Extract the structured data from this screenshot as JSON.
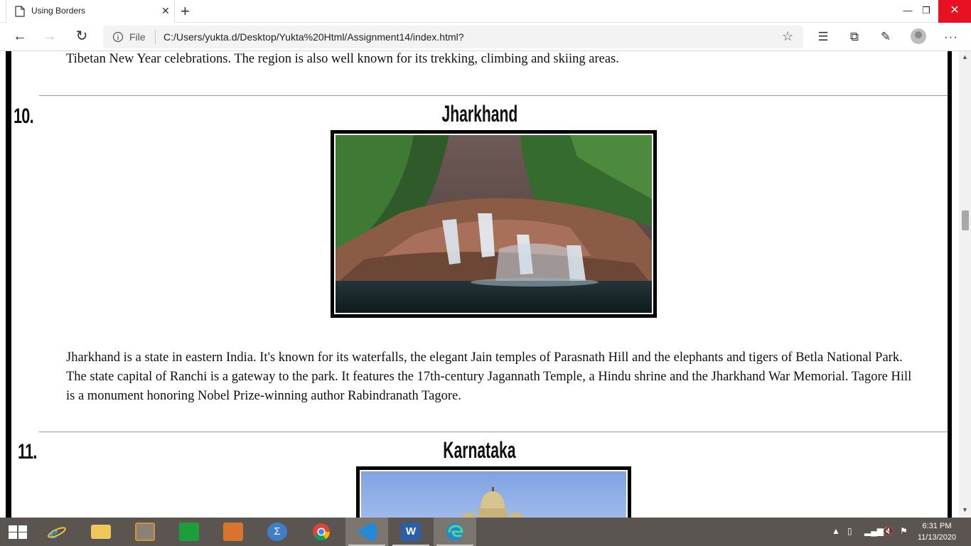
{
  "browser": {
    "tab_title": "Using Borders",
    "tab_close": "✕",
    "new_tab": "+",
    "address_scheme": "File",
    "url": "C:/Users/yukta.d/Desktop/Yukta%20Html/Assignment14/index.html?"
  },
  "page": {
    "top_paragraph": "Tibetan New Year celebrations. The region is also well known for its trekking, climbing and skiing areas.",
    "sections": [
      {
        "number": "10.",
        "title": "Jharkhand",
        "description": "Jharkhand is a state in eastern India. It's known for its waterfalls, the elegant Jain temples of Parasnath Hill and the elephants and tigers of Betla National Park. The state capital of Ranchi is a gateway to the park. It features the 17th-century Jagannath Temple, a Hindu shrine and the Jharkhand War Memorial. Tagore Hill is a monument honoring Nobel Prize-winning author Rabindranath Tagore."
      },
      {
        "number": "11.",
        "title": "Karnataka"
      }
    ]
  },
  "taskbar": {
    "apps": [
      "internet-explorer",
      "file-explorer",
      "media-app",
      "store",
      "remote-desktop",
      "math-input",
      "chrome",
      "vs-code",
      "word",
      "edge"
    ],
    "clock_time": "6:31 PM",
    "clock_date": "11/13/2020"
  },
  "colors": {
    "frame": "#000000",
    "taskbar": "#5a5550",
    "close_button": "#e81123"
  }
}
